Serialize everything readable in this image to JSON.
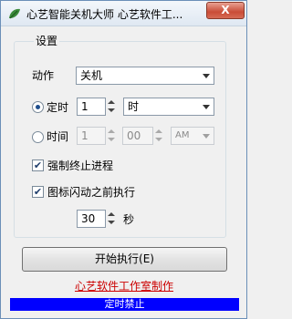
{
  "window": {
    "title": "心艺智能关机大师 心艺软件工...",
    "close_label": "X"
  },
  "settings": {
    "group_label": "设置",
    "action_label": "动作",
    "action_value": "关机",
    "timer_label": "定时",
    "timer_value": "1",
    "timer_unit": "时",
    "time_label": "时间",
    "time_hour": "1",
    "time_minute": "00",
    "time_ampm": "AM",
    "force_kill_label": "强制终止进程",
    "flash_label": "图标闪动之前执行",
    "flash_seconds": "30",
    "flash_unit": "秒"
  },
  "actions": {
    "start_label": "开始执行(E)",
    "studio_link": "心艺软件工作室制作"
  },
  "status": {
    "text": "定时禁止",
    "color": "#0000ff"
  }
}
